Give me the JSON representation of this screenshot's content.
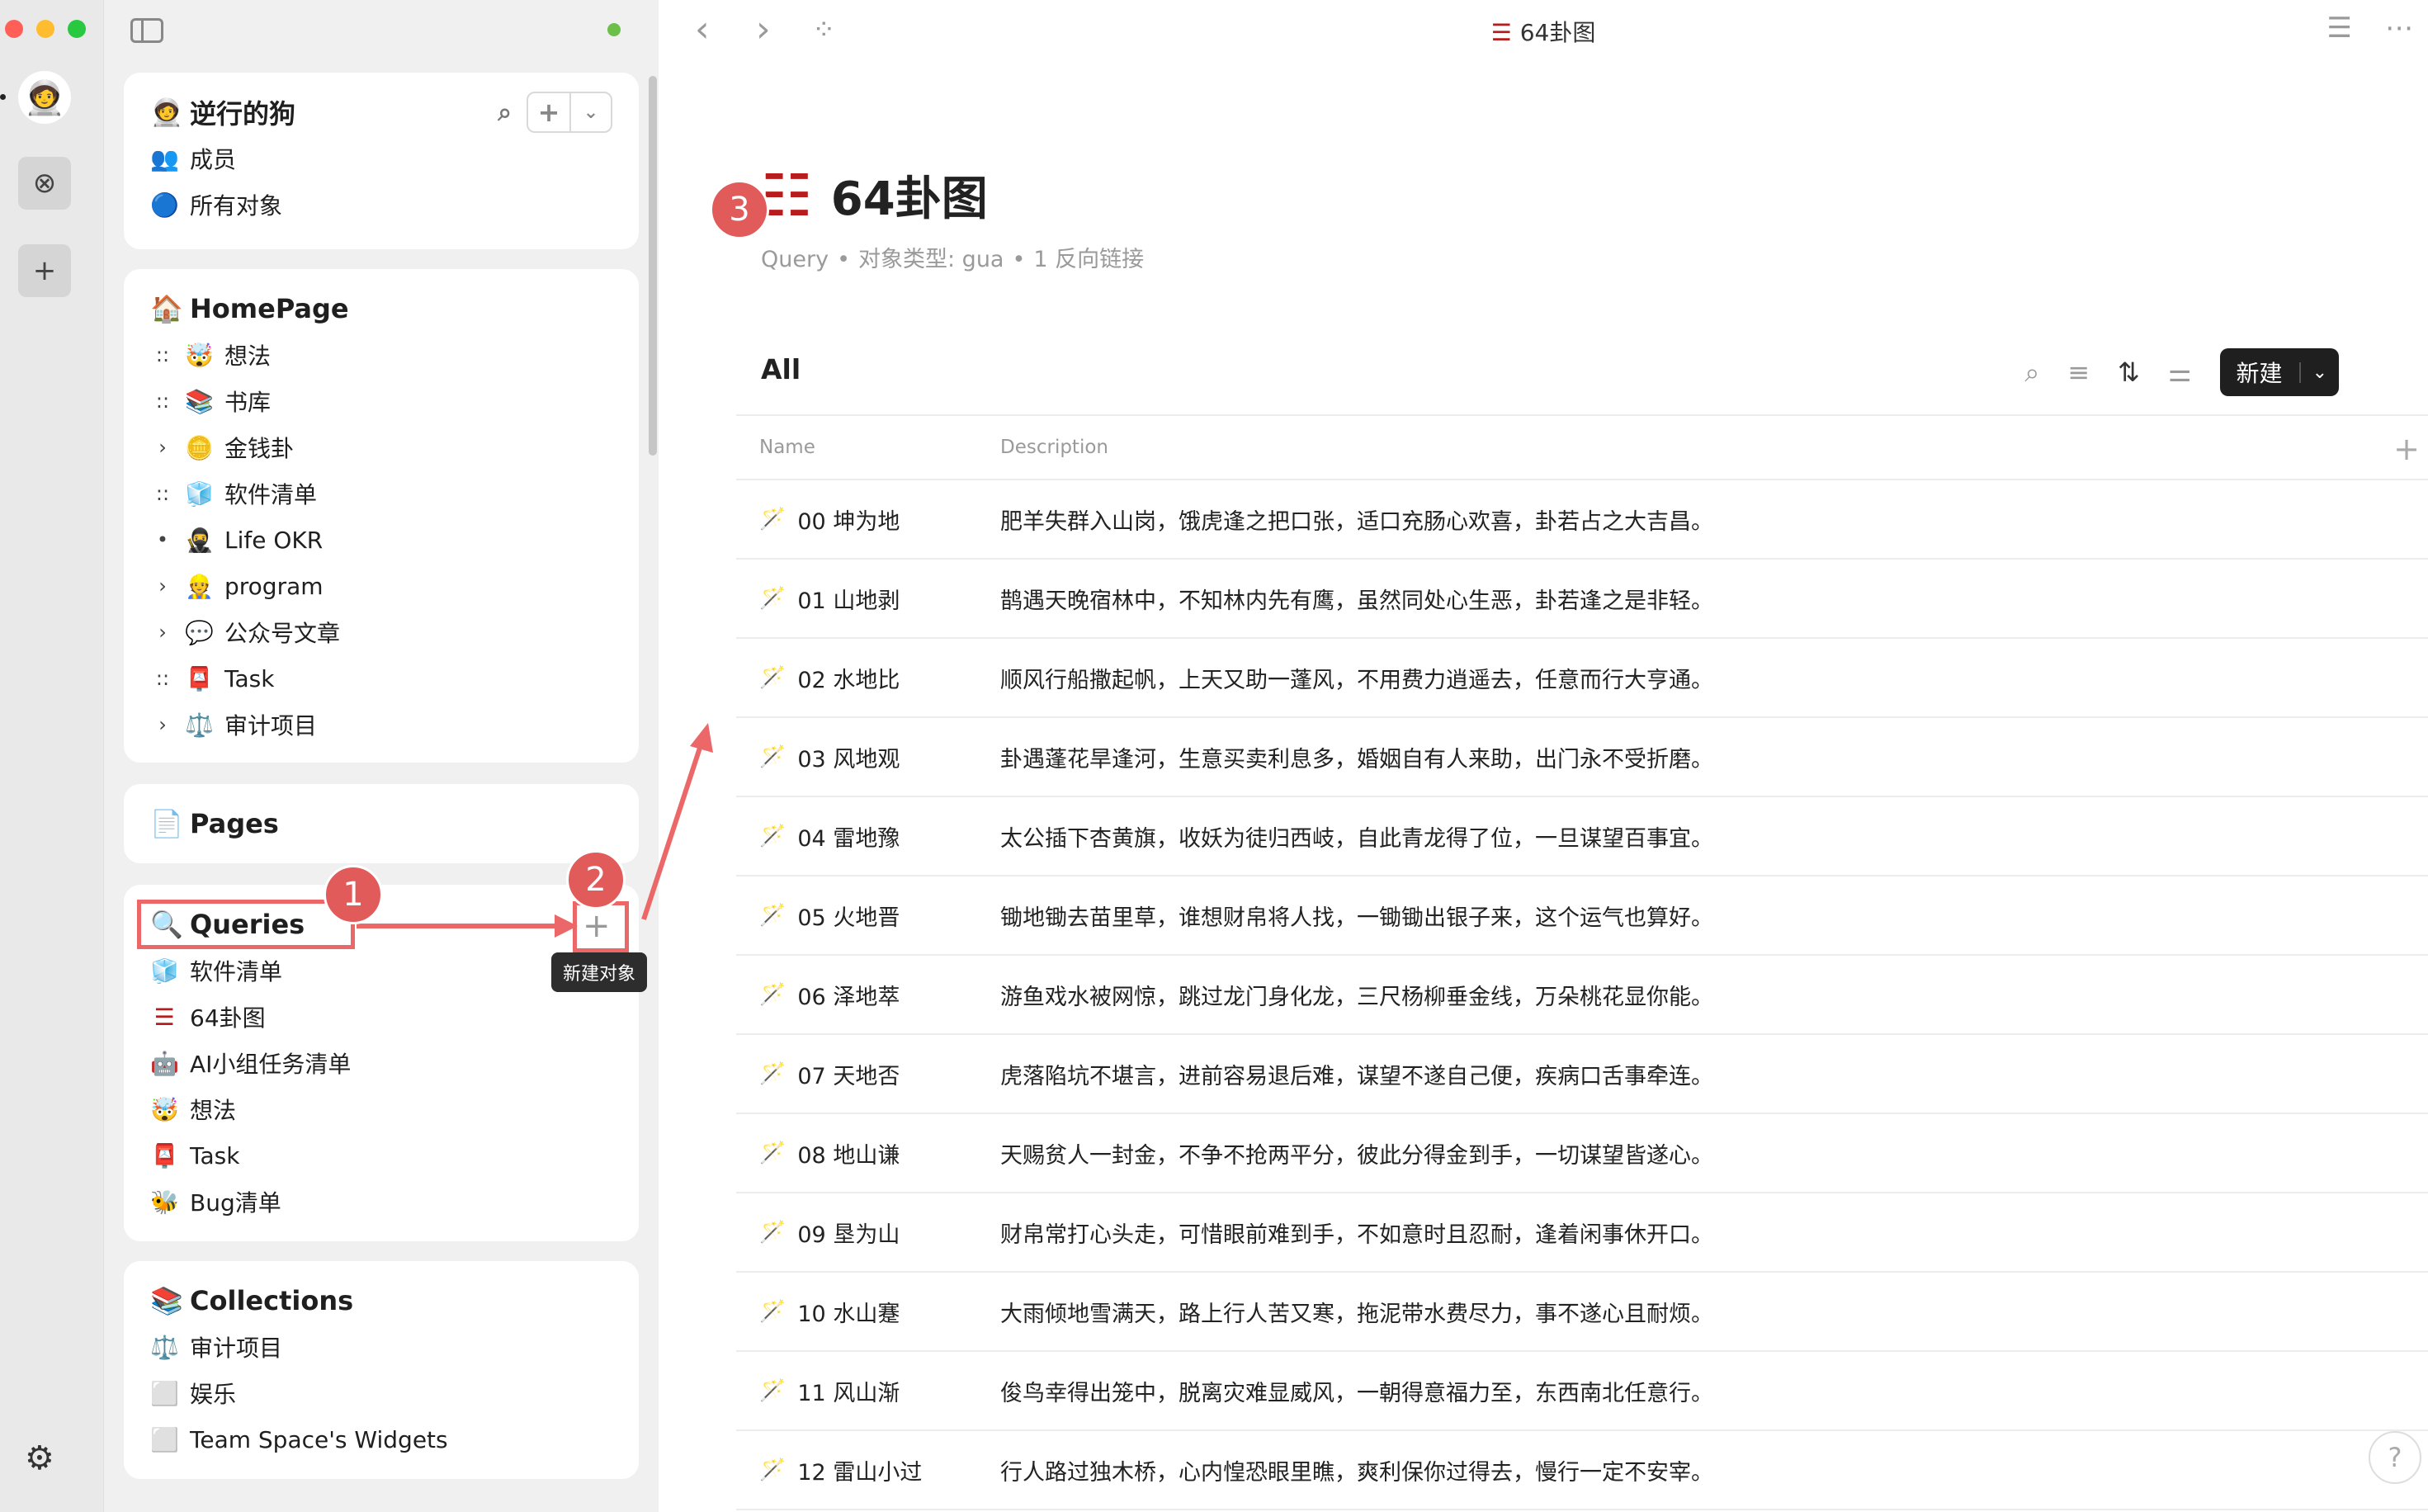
{
  "app": {
    "tab_title": "64卦图",
    "title_icon": "trigram-icon"
  },
  "rail": {
    "space_avatar": "🧑‍🚀",
    "explore_icon": "⊗",
    "add_icon": "+",
    "settings_icon": "⚙"
  },
  "workspace": {
    "name": "逆行的狗",
    "icon": "🧑‍🚀",
    "items": [
      {
        "icon": "👥",
        "label": "成员"
      },
      {
        "icon": "🔵",
        "label": "所有对象"
      }
    ]
  },
  "homepage": {
    "title": "HomePage",
    "icon": "🏠",
    "items": [
      {
        "pre": "::",
        "icon": "🤯",
        "label": "想法"
      },
      {
        "pre": "::",
        "icon": "📚",
        "label": "书库"
      },
      {
        "pre": "›",
        "icon": "🪙",
        "label": "金钱卦"
      },
      {
        "pre": "::",
        "icon": "🧊",
        "label": "软件清单"
      },
      {
        "pre": "•",
        "icon": "🥷",
        "label": "Life OKR"
      },
      {
        "pre": "›",
        "icon": "👷",
        "label": "program"
      },
      {
        "pre": "›",
        "icon": "💬",
        "label": "公众号文章"
      },
      {
        "pre": "::",
        "icon": "📮",
        "label": "Task"
      },
      {
        "pre": "›",
        "icon": "⚖️",
        "label": "审计项目"
      }
    ]
  },
  "pages": {
    "title": "Pages",
    "icon": "📄"
  },
  "queries": {
    "title": "Queries",
    "icon": "🔍",
    "new_tooltip": "新建对象",
    "items": [
      {
        "icon": "🧊",
        "label": "软件清单"
      },
      {
        "icon": "☰",
        "label": "64卦图"
      },
      {
        "icon": "🤖",
        "label": "AI小组任务清单"
      },
      {
        "icon": "🤯",
        "label": "想法"
      },
      {
        "icon": "📮",
        "label": "Task"
      },
      {
        "icon": "🐝",
        "label": "Bug清单"
      }
    ]
  },
  "collections": {
    "title": "Collections",
    "icon": "📚",
    "items": [
      {
        "icon": "⚖️",
        "label": "审计项目"
      },
      {
        "icon": "⬜",
        "label": "娱乐"
      },
      {
        "icon": "⬜",
        "label": "Team Space's Widgets"
      }
    ]
  },
  "page": {
    "title": "64卦图",
    "meta_type": "Query",
    "meta_object_type": "对象类型: gua",
    "meta_backlinks": "1 反向链接"
  },
  "view": {
    "name": "All",
    "new_label": "新建",
    "columns": {
      "name": "Name",
      "description": "Description"
    }
  },
  "rows": [
    {
      "name": "00 坤为地",
      "desc": "肥羊失群入山岗，饿虎逢之把口张，适口充肠心欢喜，卦若占之大吉昌。"
    },
    {
      "name": "01 山地剥",
      "desc": "鹊遇天晚宿林中，不知林内先有鹰，虽然同处心生恶，卦若逢之是非轻。"
    },
    {
      "name": "02 水地比",
      "desc": "顺风行船撒起帆，上天又助一蓬风，不用费力逍遥去，任意而行大亨通。"
    },
    {
      "name": "03 风地观",
      "desc": "卦遇蓬花旱逢河，生意买卖利息多，婚姻自有人来助，出门永不受折磨。"
    },
    {
      "name": "04 雷地豫",
      "desc": "太公插下杏黄旗，收妖为徒归西岐，自此青龙得了位，一旦谋望百事宜。"
    },
    {
      "name": "05 火地晋",
      "desc": "锄地锄去苗里草，谁想财帛将人找，一锄锄出银子来，这个运气也算好。"
    },
    {
      "name": "06 泽地萃",
      "desc": "游鱼戏水被网惊，跳过龙门身化龙，三尺杨柳垂金线，万朵桃花显你能。"
    },
    {
      "name": "07 天地否",
      "desc": "虎落陷坑不堪言，进前容易退后难，谋望不遂自己便，疾病口舌事牵连。"
    },
    {
      "name": "08 地山谦",
      "desc": "天赐贫人一封金，不争不抢两平分，彼此分得金到手，一切谋望皆遂心。"
    },
    {
      "name": "09 垦为山",
      "desc": "财帛常打心头走，可惜眼前难到手，不如意时且忍耐，逢着闲事休开口。"
    },
    {
      "name": "10 水山蹇",
      "desc": "大雨倾地雪满天，路上行人苦又寒，拖泥带水费尽力，事不遂心且耐烦。"
    },
    {
      "name": "11 风山渐",
      "desc": "俊鸟幸得出笼中，脱离灾难显威风，一朝得意福力至，东西南北任意行。"
    },
    {
      "name": "12 雷山小过",
      "desc": "行人路过独木桥，心内惶恐眼里瞧，爽利保你过得去，慢行一定不安宰。"
    }
  ],
  "annotations": {
    "badge1": "1",
    "badge2": "2",
    "badge3": "3",
    "color": "#e25b5b"
  }
}
